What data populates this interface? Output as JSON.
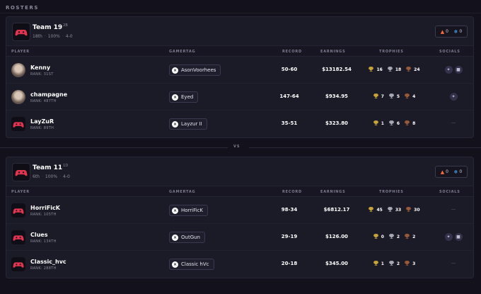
{
  "section_title": "ROSTERS",
  "vs_label": "VS",
  "columns": {
    "player": "PLAYER",
    "gamertag": "GAMERTAG",
    "record": "RECORD",
    "earnings": "EARNINGS",
    "trophies": "TROPHIES",
    "socials": "SOCIALS"
  },
  "colors": {
    "background": "#13121c",
    "card": "#1b1a27",
    "brand_red": "#e0344f",
    "gold": "#c9a43a",
    "silver": "#a8a8b4",
    "bronze": "#9a5a3a"
  },
  "teams": [
    {
      "name": "Team 19",
      "tag": "2B",
      "place": "18th",
      "percent": "100%",
      "record": "4-0",
      "fire": "0",
      "ice": "0",
      "players": [
        {
          "name": "Kenny",
          "rank": "RANK: 31ST",
          "avatar": "photo",
          "gamertag": "AsonVoorhees",
          "record": "50-60",
          "earnings": "$13182.54",
          "gold": "16",
          "silver": "18",
          "bronze": "24",
          "socials": [
            "twitter-icon",
            "twitch-icon"
          ]
        },
        {
          "name": "champagne",
          "rank": "RANK: 487TH",
          "avatar": "photo",
          "gamertag": "Eyed",
          "record": "147-64",
          "earnings": "$934.95",
          "gold": "7",
          "silver": "5",
          "bronze": "4",
          "socials": [
            "twitter-icon"
          ]
        },
        {
          "name": "LayZuR",
          "rank": "RANK: 89TH",
          "avatar": "logo",
          "gamertag": "Layzur II",
          "record": "35-51",
          "earnings": "$323.80",
          "gold": "1",
          "silver": "6",
          "bronze": "8",
          "socials": []
        }
      ]
    },
    {
      "name": "Team 11",
      "tag": "1D",
      "place": "6th",
      "percent": "100%",
      "record": "4-0",
      "fire": "0",
      "ice": "0",
      "players": [
        {
          "name": "HorriFicK",
          "rank": "RANK: 105TH",
          "avatar": "logo",
          "gamertag": "HorriFicK",
          "record": "98-34",
          "earnings": "$6812.17",
          "gold": "45",
          "silver": "33",
          "bronze": "30",
          "socials": []
        },
        {
          "name": "Clues",
          "rank": "RANK: 134TH",
          "avatar": "logo",
          "gamertag": "OutGun",
          "record": "29-19",
          "earnings": "$126.00",
          "gold": "0",
          "silver": "2",
          "bronze": "2",
          "socials": [
            "twitter-icon",
            "twitch-icon"
          ]
        },
        {
          "name": "Classic_hvc",
          "rank": "RANK: 288TH",
          "avatar": "logo",
          "gamertag": "Classic hVc",
          "record": "20-18",
          "earnings": "$345.00",
          "gold": "1",
          "silver": "2",
          "bronze": "3",
          "socials": []
        }
      ]
    }
  ],
  "dash": "—"
}
